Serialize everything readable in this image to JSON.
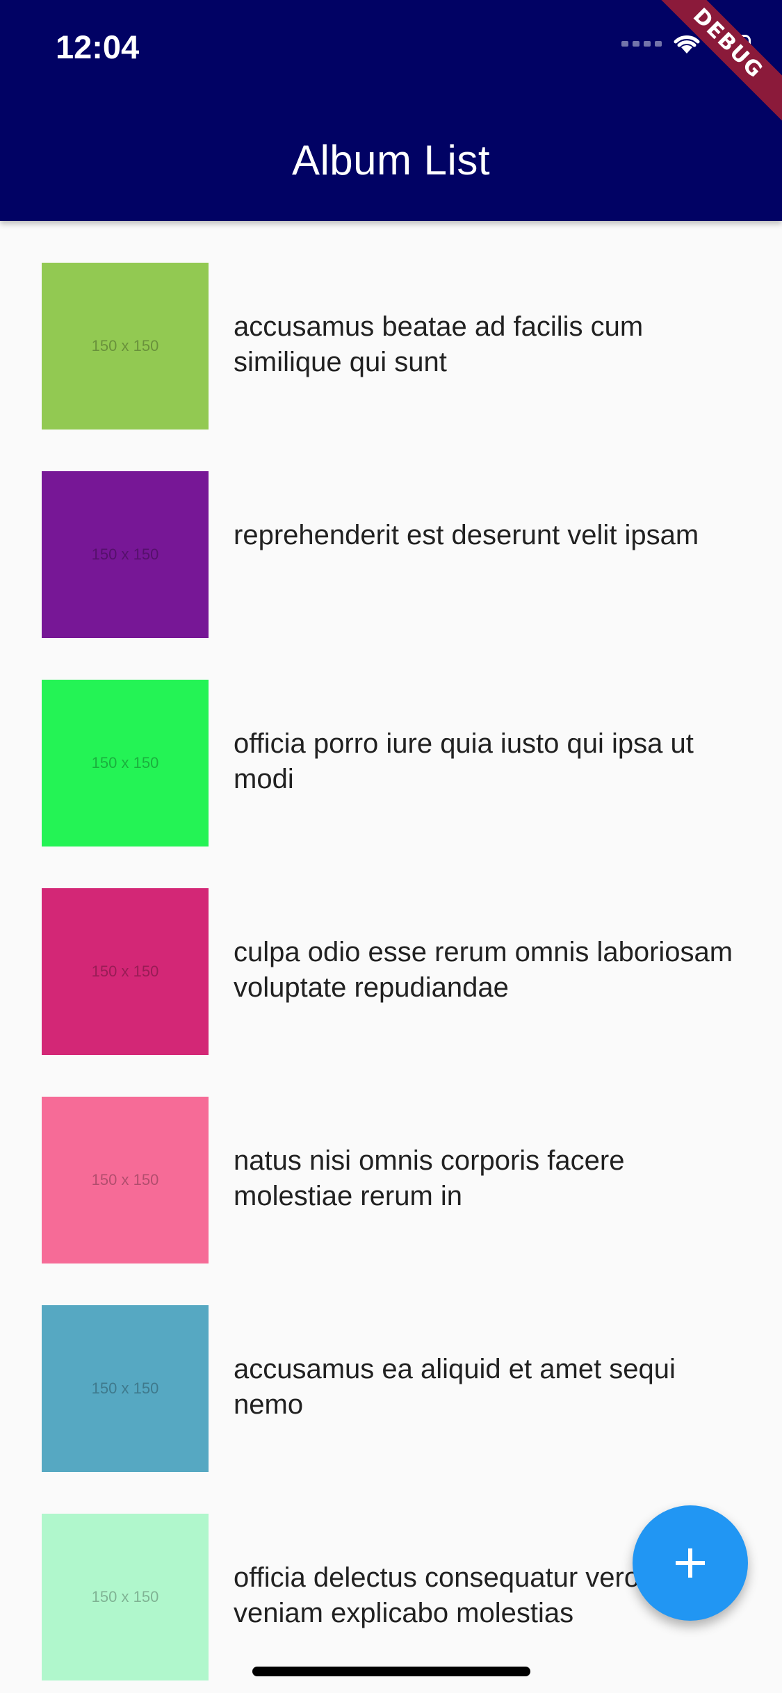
{
  "status_bar": {
    "time": "12:04"
  },
  "debug_banner": {
    "label": "DEBUG",
    "color": "#8b1a3a"
  },
  "app_bar": {
    "title": "Album List",
    "background": "#010264"
  },
  "albums": [
    {
      "title": "accusamus beatae ad facilis cum similique qui sunt",
      "thumbnail_label": "150 x 150",
      "color": "#92c952"
    },
    {
      "title": "reprehenderit est deserunt velit ipsam",
      "thumbnail_label": "150 x 150",
      "color": "#771796"
    },
    {
      "title": "officia porro iure quia iusto qui ipsa ut modi",
      "thumbnail_label": "150 x 150",
      "color": "#24f355"
    },
    {
      "title": "culpa odio esse rerum omnis laboriosam voluptate repudiandae",
      "thumbnail_label": "150 x 150",
      "color": "#d32776"
    },
    {
      "title": "natus nisi omnis corporis facere molestiae rerum in",
      "thumbnail_label": "150 x 150",
      "color": "#f66b97"
    },
    {
      "title": "accusamus ea aliquid et amet sequi nemo",
      "thumbnail_label": "150 x 150",
      "color": "#56a8c2"
    },
    {
      "title": "officia delectus consequatur vero aut veniam explicabo molestias",
      "thumbnail_label": "150 x 150",
      "color": "#b0f7cc"
    }
  ],
  "fab": {
    "icon": "add-icon",
    "color": "#2196f3"
  }
}
